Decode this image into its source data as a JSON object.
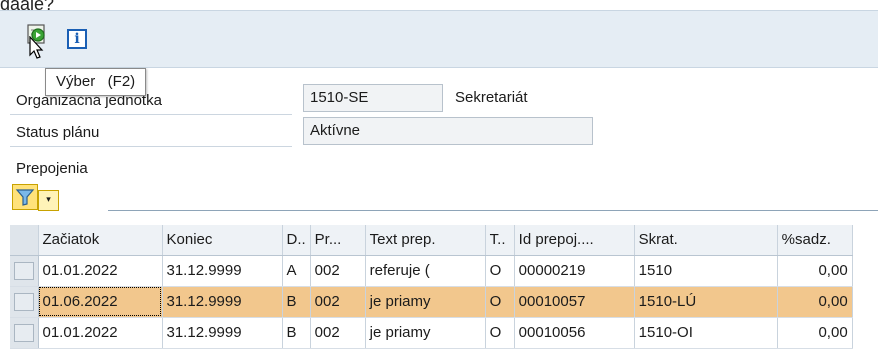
{
  "top_fragment": "daaje?",
  "toolbar": {
    "execute_icon": "execute-icon",
    "info_icon": "info-icon",
    "info_glyph": "i",
    "tooltip": "Výber   (F2)"
  },
  "form": {
    "org_unit_label": "Organizačná jednotka",
    "org_unit_value": "1510-SE",
    "org_unit_desc": "Sekretariát",
    "status_label": "Status plánu",
    "status_value": "Aktívne"
  },
  "section_title": "Prepojenia",
  "colors": {
    "toolbar_bg": "#e5edf4",
    "highlight_row": "#f2c78d"
  },
  "table": {
    "columns": [
      "Začiatok",
      "Koniec",
      "D..",
      "Pr...",
      "Text prep.",
      "T..",
      "Id prepoj....",
      "Skrat.",
      "%sadz."
    ],
    "rows": [
      [
        "01.01.2022",
        "31.12.9999",
        "A",
        "002",
        "referuje (",
        "O",
        "00000219",
        "1510",
        "0,00"
      ],
      [
        "01.06.2022",
        "31.12.9999",
        "B",
        "002",
        "je priamy",
        "O",
        "00010057",
        "1510-LÚ",
        "0,00"
      ],
      [
        "01.01.2022",
        "31.12.9999",
        "B",
        "002",
        "je priamy",
        "O",
        "00010056",
        "1510-OI",
        "0,00"
      ]
    ]
  }
}
